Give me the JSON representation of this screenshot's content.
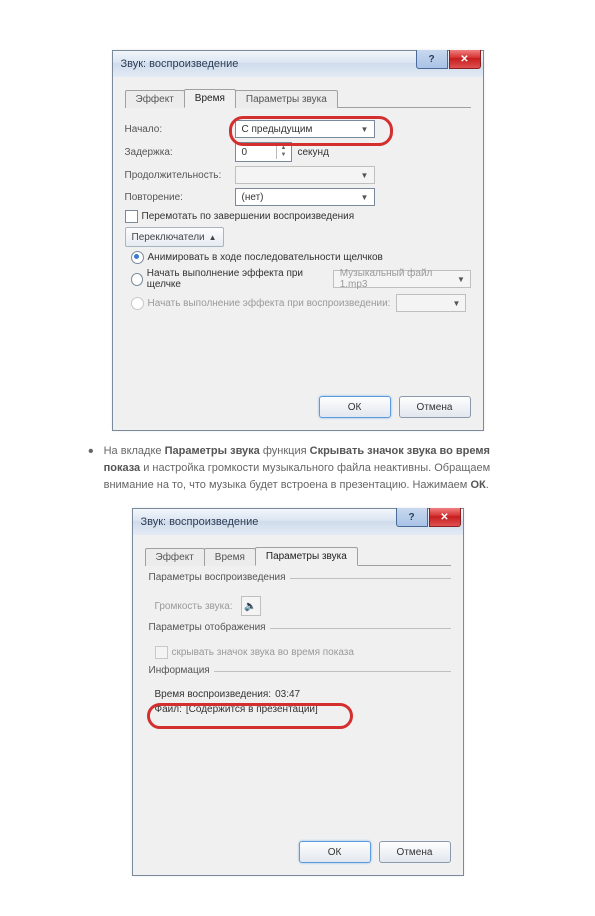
{
  "dlg1": {
    "title": "Звук: воспроизведение",
    "tabs": {
      "effect": "Эффект",
      "time": "Время",
      "params": "Параметры звука"
    },
    "start_label": "Начало:",
    "start_value": "С предыдущим",
    "delay_label": "Задержка:",
    "delay_value": "0",
    "delay_unit": "секунд",
    "duration_label": "Продолжительность:",
    "repeat_label": "Повторение:",
    "repeat_value": "(нет)",
    "rewind_label": "Перемотать по завершении воспроизведения",
    "triggers_btn": "Переключатели",
    "opt_seq": "Анимировать в ходе последовательности щелчков",
    "opt_click": "Начать выполнение эффекта при щелчке",
    "opt_click_val": "Музыкальный файл 1.mp3",
    "opt_play": "Начать выполнение эффекта при воспроизведении:",
    "ok": "ОК",
    "cancel": "Отмена"
  },
  "para": {
    "text1": "На вкладке ",
    "b1": "Параметры звука",
    "text2": " функция ",
    "b2": "Скрывать значок звука во время показа",
    "text3": " и настройка громкости музыкального файла неактивны. Обращаем внимание на то, что музыка будет встроена в презентацию. Нажимаем ",
    "b3": "ОК",
    "text4": "."
  },
  "dlg2": {
    "title": "Звук: воспроизведение",
    "tabs": {
      "effect": "Эффект",
      "time": "Время",
      "params": "Параметры звука"
    },
    "grp_play": "Параметры воспроизведения",
    "vol_label": "Громкость звука:",
    "grp_disp": "Параметры отображения",
    "hide_label": "скрывать значок звука во время показа",
    "grp_info": "Информация",
    "len_label": "Время воспроизведения:",
    "len_value": "03:47",
    "file_label": "Файл:",
    "file_value": "[Содержится в презентации]",
    "ok": "ОК",
    "cancel": "Отмена"
  }
}
